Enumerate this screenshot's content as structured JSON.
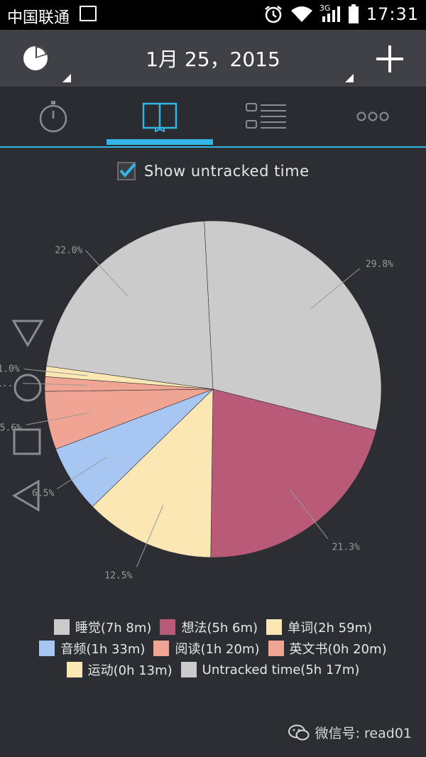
{
  "status_bar": {
    "carrier": "中国联通",
    "network": "3G",
    "time": "17:31"
  },
  "toolbar": {
    "date": "1月 25，2015",
    "add_icon": "plus-icon",
    "chart_icon": "pie-chart-icon"
  },
  "tabs": [
    {
      "icon": "stopwatch-icon",
      "active": false
    },
    {
      "icon": "book-icon",
      "active": true
    },
    {
      "icon": "list-icon",
      "active": false
    },
    {
      "icon": "more-icon",
      "active": false
    }
  ],
  "show_untracked": {
    "label": "Show untracked time",
    "checked": true
  },
  "colors": {
    "accent": "#33b5e5",
    "background": "#2c2e33"
  },
  "chart_data": {
    "type": "pie",
    "slices": [
      {
        "label": "Untracked time(5h 17m)",
        "value": 29.8,
        "percent_label": "29.8%",
        "color": "#cbcbcb"
      },
      {
        "label": "想法(5h 6m)",
        "value": 21.3,
        "percent_label": "21.3%",
        "color": "#b85a78"
      },
      {
        "label": "单词(2h 59m)",
        "value": 12.5,
        "percent_label": "12.5%",
        "color": "#fbe7b4"
      },
      {
        "label": "音频(1h 33m)",
        "value": 6.5,
        "percent_label": "6.5%",
        "color": "#a8c6f2"
      },
      {
        "label": "阅读(1h 20m)",
        "value": 5.6,
        "percent_label": "5.6%",
        "color": "#f0a594"
      },
      {
        "label": "英文书(0h 20m)",
        "value": 1.4,
        "percent_label": "1...",
        "color": "#f0a594"
      },
      {
        "label": "运动(0h 13m)",
        "value": 1.0,
        "percent_label": "1.0%",
        "color": "#fbe7b4"
      },
      {
        "label": "睡觉(7h 8m)",
        "value": 22.0,
        "percent_label": "22.0%",
        "color": "#cbcbcb"
      }
    ]
  },
  "legend": {
    "rows": [
      [
        {
          "label": "睡觉(7h 8m)",
          "color": "#cbcbcb"
        },
        {
          "label": "想法(5h 6m)",
          "color": "#b85a78"
        },
        {
          "label": "单词(2h 59m)",
          "color": "#fbe7b4"
        }
      ],
      [
        {
          "label": "音频(1h 33m)",
          "color": "#a8c6f2"
        },
        {
          "label": "阅读(1h 20m)",
          "color": "#f0a594"
        },
        {
          "label": "英文书(0h 20m)",
          "color": "#f0a594"
        }
      ],
      [
        {
          "label": "运动(0h 13m)",
          "color": "#fbe7b4"
        },
        {
          "label": "Untracked time(5h 17m)",
          "color": "#cbcbcb"
        }
      ]
    ]
  },
  "watermark": {
    "text": "微信号: read01"
  }
}
